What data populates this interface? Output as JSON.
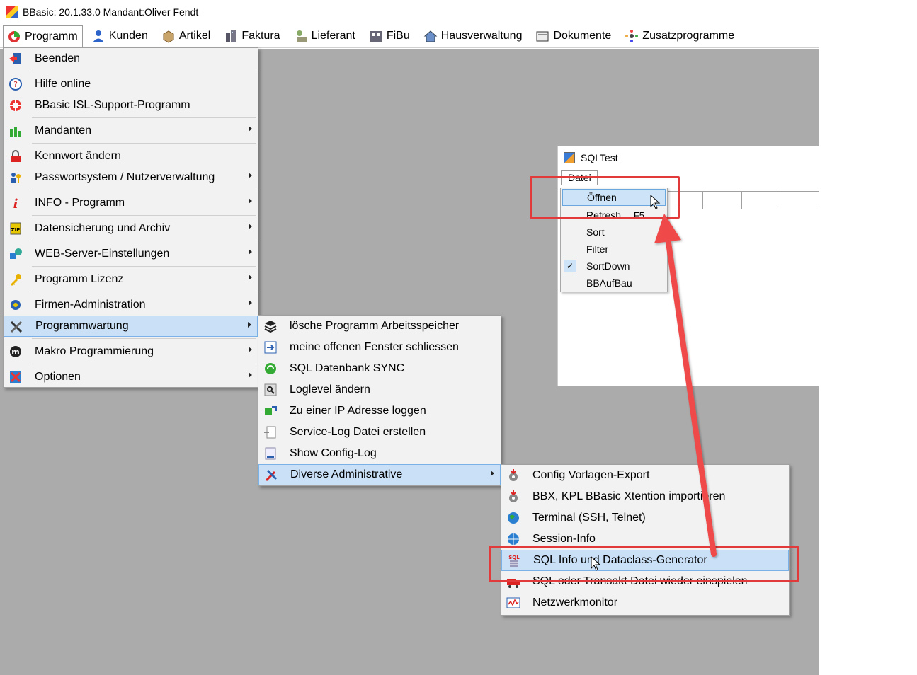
{
  "window": {
    "title": "BBasic: 20.1.33.0 Mandant:Oliver Fendt"
  },
  "menubar": {
    "items": [
      {
        "label": "Programm",
        "icon": "programm-icon"
      },
      {
        "label": "Kunden",
        "icon": "kunden-icon"
      },
      {
        "label": "Artikel",
        "icon": "artikel-icon"
      },
      {
        "label": "Faktura",
        "icon": "faktura-icon"
      },
      {
        "label": "Lieferant",
        "icon": "lieferant-icon"
      },
      {
        "label": "FiBu",
        "icon": "fibu-icon"
      },
      {
        "label": "Hausverwaltung",
        "icon": "hausverwaltung-icon"
      },
      {
        "label": "Dokumente",
        "icon": "dokumente-icon"
      },
      {
        "label": "Zusatzprogramme",
        "icon": "zusatzprogramme-icon"
      }
    ]
  },
  "programm_menu": {
    "items": [
      {
        "label": "Beenden"
      },
      {
        "label": "Hilfe online"
      },
      {
        "label": "BBasic ISL-Support-Programm"
      },
      {
        "label": "Mandanten"
      },
      {
        "label": "Kennwort ändern"
      },
      {
        "label": "Passwortsystem / Nutzerverwaltung"
      },
      {
        "label": "INFO - Programm"
      },
      {
        "label": "Datensicherung und Archiv"
      },
      {
        "label": "WEB-Server-Einstellungen"
      },
      {
        "label": "Programm Lizenz"
      },
      {
        "label": "Firmen-Administration"
      },
      {
        "label": "Programmwartung"
      },
      {
        "label": "Makro Programmierung"
      },
      {
        "label": "Optionen"
      }
    ]
  },
  "wartung_menu": {
    "items": [
      {
        "label": "lösche Programm Arbeitsspeicher"
      },
      {
        "label": "meine offenen Fenster schliessen"
      },
      {
        "label": "SQL Datenbank SYNC"
      },
      {
        "label": "Loglevel ändern"
      },
      {
        "label": "Zu einer IP Adresse loggen"
      },
      {
        "label": "Service-Log Datei erstellen"
      },
      {
        "label": "Show Config-Log"
      },
      {
        "label": "Diverse Administrative"
      }
    ]
  },
  "admin_menu": {
    "items": [
      {
        "label": "Config Vorlagen-Export"
      },
      {
        "label": "BBX, KPL BBasic Xtention importieren"
      },
      {
        "label": "Terminal (SSH, Telnet)"
      },
      {
        "label": "Session-Info"
      },
      {
        "label": "SQL Info und Dataclass-Generator"
      },
      {
        "label": "SQL oder Transakt Datei wieder einspielen"
      },
      {
        "label": "Netzwerkmonitor"
      }
    ]
  },
  "sqltest": {
    "title": "SQLTest",
    "menu_label": "Datei",
    "datei_menu": {
      "items": [
        {
          "label": "Öffnen"
        },
        {
          "label": "Refresh",
          "shortcut": "F5"
        },
        {
          "label": "Sort"
        },
        {
          "label": "Filter"
        },
        {
          "label": "SortDown",
          "checked": true
        },
        {
          "label": "BBAufBau"
        }
      ]
    }
  },
  "annotation": {
    "color": "#e23a3a"
  }
}
